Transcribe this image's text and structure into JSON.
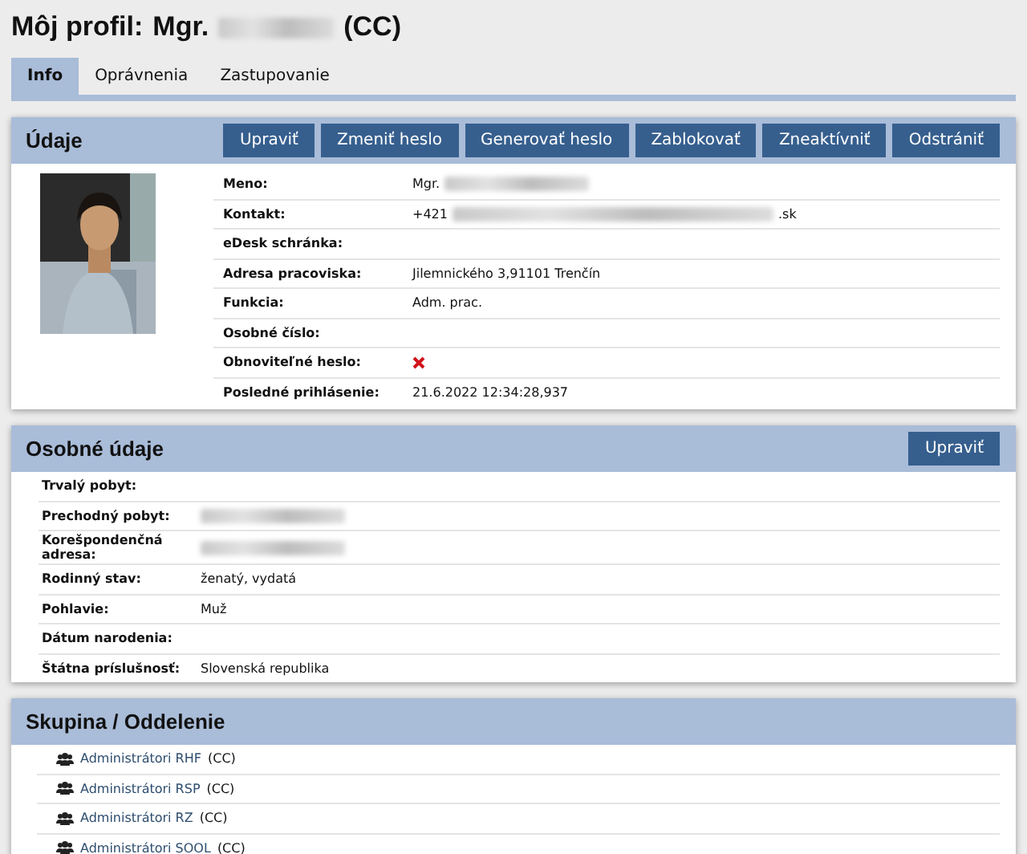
{
  "page_title": {
    "prefix": "Môj profil:",
    "name": "Mgr.",
    "name_redacted": true,
    "suffix": "(CC)"
  },
  "tabs": [
    {
      "label": "Info",
      "selected": true
    },
    {
      "label": "Oprávnenia",
      "selected": false
    },
    {
      "label": "Zastupovanie",
      "selected": false
    }
  ],
  "udaje": {
    "title": "Údaje",
    "buttons": [
      "Upraviť",
      "Zmeniť heslo",
      "Generovať heslo",
      "Zablokovať",
      "Zneaktívniť",
      "Odstrániť"
    ],
    "photo": {
      "kind": "picture"
    },
    "rows": [
      {
        "label": "Meno:",
        "value": "Mgr.",
        "redacted": true
      },
      {
        "label": "Kontakt:",
        "value": "+421",
        "redacted": true,
        "value_end": ".sk"
      },
      {
        "label": "eDesk schránka:",
        "value": "",
        "redacted": false
      },
      {
        "label": "Adresa pracoviska:",
        "value": "Jilemnického 3,91101 Trenčín",
        "redacted": false
      },
      {
        "label": "Funkcia:",
        "value": "Adm. prac.",
        "redacted": false
      },
      {
        "label": "Osobné číslo:",
        "value": "",
        "redacted": false
      },
      {
        "label": "Obnoviteľné heslo:",
        "value": "",
        "redacted": false,
        "flag": false
      },
      {
        "label": "Posledné prihlásenie:",
        "value": "21.6.2022 12:34:28,937",
        "redacted": false
      }
    ]
  },
  "osobne_udaje": {
    "title": "Osobné údaje",
    "buttons": [
      "Upraviť"
    ],
    "rows": [
      {
        "label": "Trvalý pobyt:",
        "value": "",
        "redacted": false
      },
      {
        "label": "Prechodný pobyt:",
        "value": "",
        "redacted": true
      },
      {
        "label": "Korešpondenčná adresa:",
        "value": "",
        "redacted": true
      },
      {
        "label": "Rodinný stav:",
        "value": "ženatý, vydatá",
        "redacted": false
      },
      {
        "label": "Pohlavie:",
        "value": "Muž",
        "redacted": false
      },
      {
        "label": "Dátum narodenia:",
        "value": "",
        "redacted": false
      },
      {
        "label": "Štátna príslušnosť:",
        "value": "Slovenská republika",
        "redacted": false
      }
    ]
  },
  "skupina": {
    "title": "Skupina / Oddelenie",
    "items": [
      {
        "name": "Administrátori RHF",
        "org": "(CC)"
      },
      {
        "name": "Administrátori RSP",
        "org": "(CC)"
      },
      {
        "name": "Administrátori RZ",
        "org": "(CC)"
      },
      {
        "name": "Administrátori SOOL",
        "org": "(CC)"
      }
    ]
  }
}
